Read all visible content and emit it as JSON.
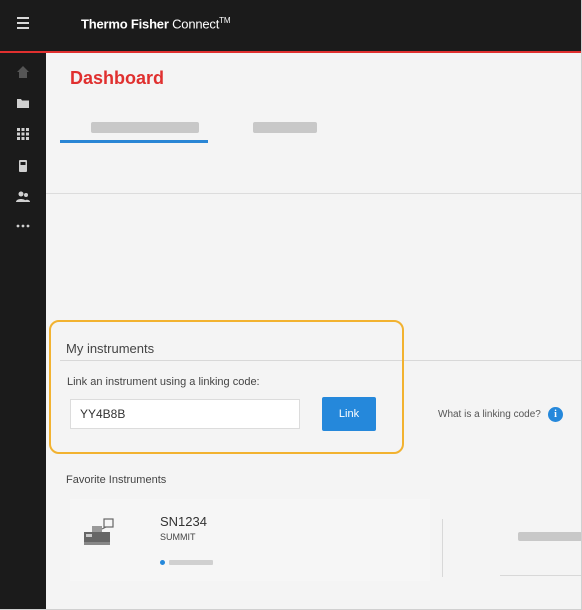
{
  "app": {
    "brand_bold": "Thermo Fisher",
    "brand_light": " Connect",
    "brand_tm": "TM"
  },
  "sidebar": {
    "items": [
      {
        "icon": "home-icon"
      },
      {
        "icon": "folder-icon"
      },
      {
        "icon": "grid-icon"
      },
      {
        "icon": "device-icon"
      },
      {
        "icon": "people-icon"
      },
      {
        "icon": "more-icon"
      }
    ]
  },
  "page": {
    "title": "Dashboard"
  },
  "instruments": {
    "section_title": "My instruments",
    "link_prompt": "Link an instrument using a linking code:",
    "code_value": "YY4B8B",
    "link_button": "Link",
    "help_text": "What is a linking code?",
    "info_glyph": "i"
  },
  "favorites": {
    "title": "Favorite Instruments",
    "items": [
      {
        "serial": "SN1234",
        "model": "SUMMIT",
        "icon": "instrument-icon"
      }
    ]
  },
  "colors": {
    "accent": "#e0302f",
    "primary": "#2588db",
    "highlight": "#f2b230",
    "topbar": "#1b1b1b"
  }
}
